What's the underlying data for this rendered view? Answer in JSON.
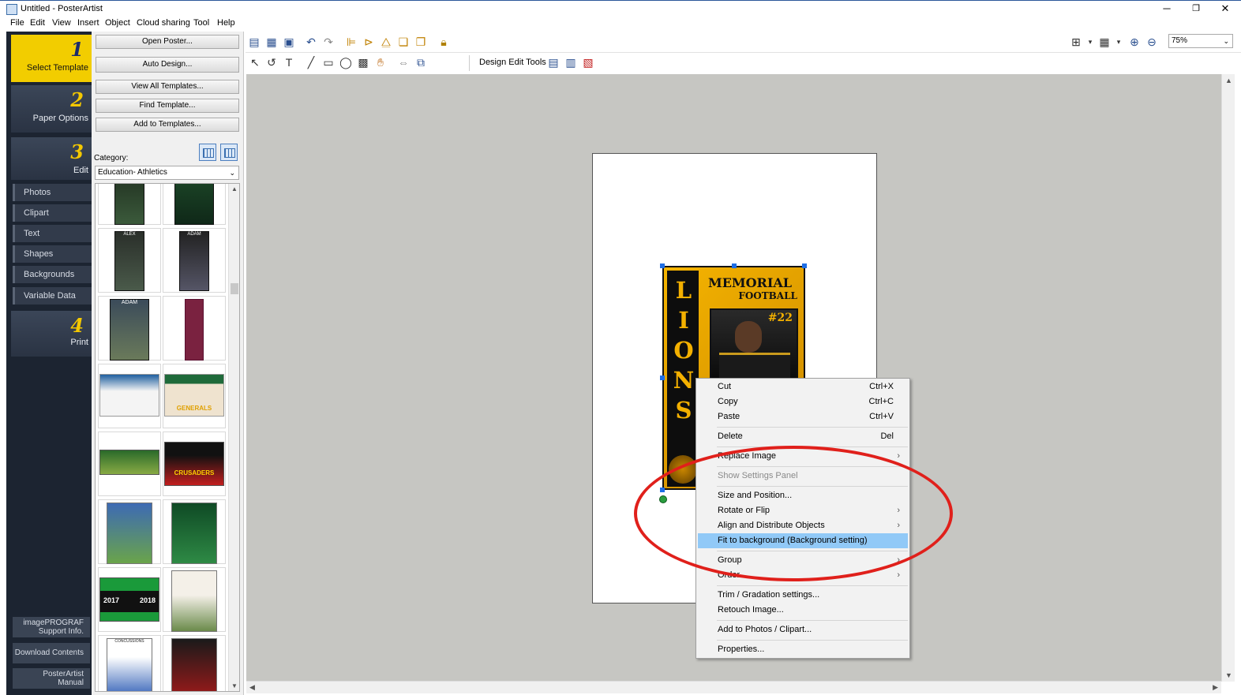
{
  "window": {
    "title": "Untitled - PosterArtist",
    "controls": [
      "─",
      "❐",
      "✕"
    ]
  },
  "menu": [
    "File",
    "Edit",
    "View",
    "Insert",
    "Object",
    "Cloud sharing",
    "Tool",
    "Help"
  ],
  "steps": [
    {
      "num": "1",
      "label": "Select Template"
    },
    {
      "num": "2",
      "label": "Paper Options"
    },
    {
      "num": "3",
      "label": "Edit"
    },
    {
      "num": "4",
      "label": "Print"
    }
  ],
  "edit_items": [
    "Photos",
    "Clipart",
    "Text",
    "Shapes",
    "Backgrounds",
    "Variable Data"
  ],
  "bottom_buttons": [
    {
      "line1": "imagePROGRAF",
      "line2": "Support Info."
    },
    {
      "line1": "Download Contents",
      "line2": ""
    },
    {
      "line1": "PosterArtist",
      "line2": "Manual"
    }
  ],
  "panel": {
    "buttons": [
      "Open Poster...",
      "Auto Design...",
      "View All Templates...",
      "Find Template...",
      "Add to Templates..."
    ],
    "category_label": "Category:",
    "category_value": "Education- Athletics"
  },
  "toolbar": {
    "design_edit_tools": "Design Edit Tools",
    "zoom": "75%"
  },
  "poster": {
    "letters": [
      "L",
      "I",
      "O",
      "N",
      "S"
    ],
    "heading1": "MEMORIAL",
    "heading2": "FOOTBALL",
    "number": "#22"
  },
  "thumb_texts": {
    "t3": "ALEX",
    "t4": "ADAM",
    "t5": "ADAM",
    "t8": "GENERALS",
    "t10": "CRUSADERS",
    "t13a": "2017",
    "t13b": "2018",
    "t15": "CONCUSSIONS"
  },
  "context_menu": {
    "cut": {
      "label": "Cut",
      "shortcut": "Ctrl+X"
    },
    "copy": {
      "label": "Copy",
      "shortcut": "Ctrl+C"
    },
    "paste": {
      "label": "Paste",
      "shortcut": "Ctrl+V"
    },
    "delete": {
      "label": "Delete",
      "shortcut": "Del"
    },
    "replace_image": "Replace Image",
    "show_settings": "Show Settings Panel",
    "size_position": "Size and Position...",
    "rotate_flip": "Rotate or Flip",
    "align_distribute": "Align and Distribute Objects",
    "fit_background": "Fit to background (Background setting)",
    "group": "Group",
    "order": "Order",
    "trim_gradation": "Trim / Gradation settings...",
    "retouch": "Retouch Image...",
    "add_photos": "Add to Photos / Clipart...",
    "properties": "Properties..."
  },
  "colors": {
    "accent_yellow": "#f2cd00",
    "sidebar_dark": "#1c2431",
    "selection_handle": "#1e6ee6",
    "menu_highlight": "#91c9f7",
    "annotation_red": "#e0201b"
  }
}
